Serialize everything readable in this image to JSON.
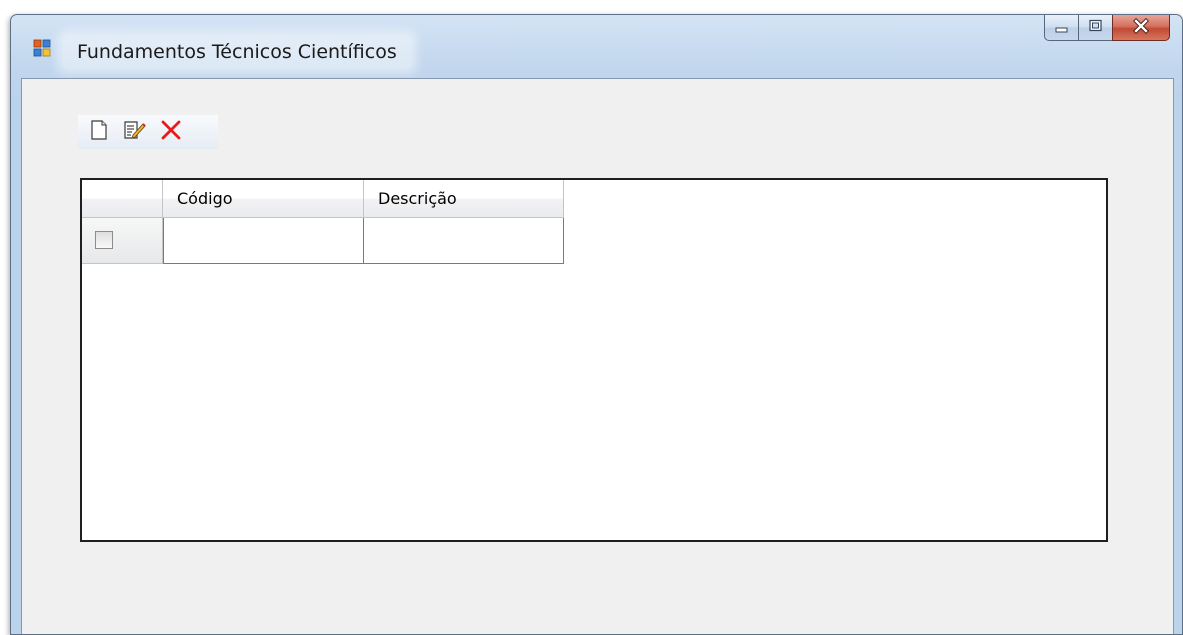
{
  "window": {
    "title": "Fundamentos Técnicos Científicos",
    "icon": "form-app-icon",
    "caption_buttons": [
      "minimize-icon",
      "maximize-icon",
      "close-icon"
    ]
  },
  "toolbar": {
    "buttons": [
      {
        "name": "new",
        "icon": "new-document-icon"
      },
      {
        "name": "edit",
        "icon": "edit-document-icon"
      },
      {
        "name": "delete",
        "icon": "delete-x-icon"
      }
    ]
  },
  "grid": {
    "columns": [
      "Código",
      "Descrição"
    ],
    "rows": [
      {
        "checked": false,
        "codigo": "",
        "descricao": ""
      }
    ]
  },
  "colors": {
    "delete_icon": "#e81b1b",
    "titlebar": "#c5d9ef",
    "client_bg": "#f0f0f0"
  }
}
